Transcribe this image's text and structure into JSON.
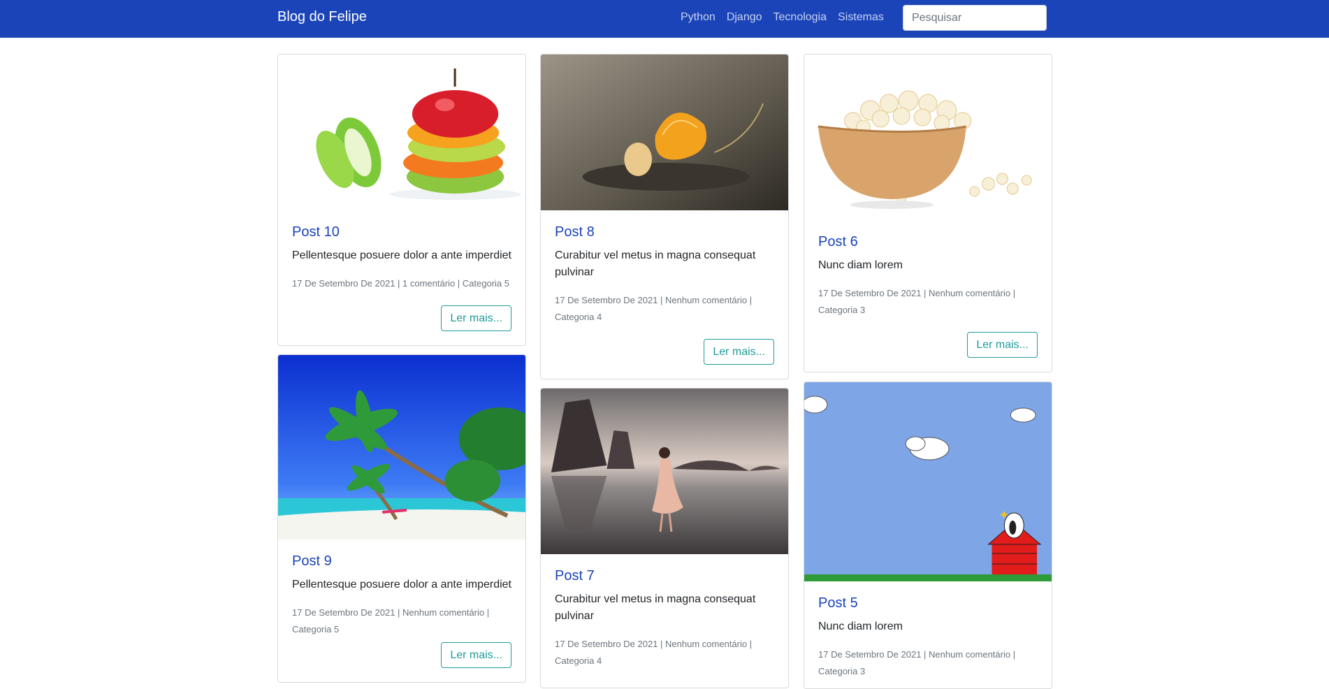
{
  "brand": "Blog do Felipe",
  "nav": [
    "Python",
    "Django",
    "Tecnologia",
    "Sistemas"
  ],
  "search": {
    "placeholder": "Pesquisar"
  },
  "read_more": "Ler mais...",
  "posts": [
    {
      "title": "Post 10",
      "text": "Pellentesque posuere dolor a ante imperdiet",
      "meta": "17 De Setembro De 2021 | 1 comentário | Categoria 5",
      "image": "fruit-slices"
    },
    {
      "title": "Post 8",
      "text": "Curabitur vel metus in magna consequat pulvinar",
      "meta": "17 De Setembro De 2021 | Nenhum comentário | Categoria 4",
      "image": "orange-segment"
    },
    {
      "title": "Post 6",
      "text": "Nunc diam lorem",
      "meta": "17 De Setembro De 2021 | Nenhum comentário | Categoria 3",
      "image": "popcorn-bowl"
    },
    {
      "title": "Post 9",
      "text": "Pellentesque posuere dolor a ante imperdiet",
      "meta": "17 De Setembro De 2021 | Nenhum comentário | Categoria 5",
      "image": "tropical-beach"
    },
    {
      "title": "Post 7",
      "text": "Curabitur vel metus in magna consequat pulvinar",
      "meta": "17 De Setembro De 2021 | Nenhum comentário | Categoria 4",
      "image": "woman-on-beach"
    },
    {
      "title": "Post 5",
      "text": "Nunc diam lorem",
      "meta": "17 De Setembro De 2021 | Nenhum comentário | Categoria 3",
      "image": "snoopy-doghouse"
    }
  ]
}
